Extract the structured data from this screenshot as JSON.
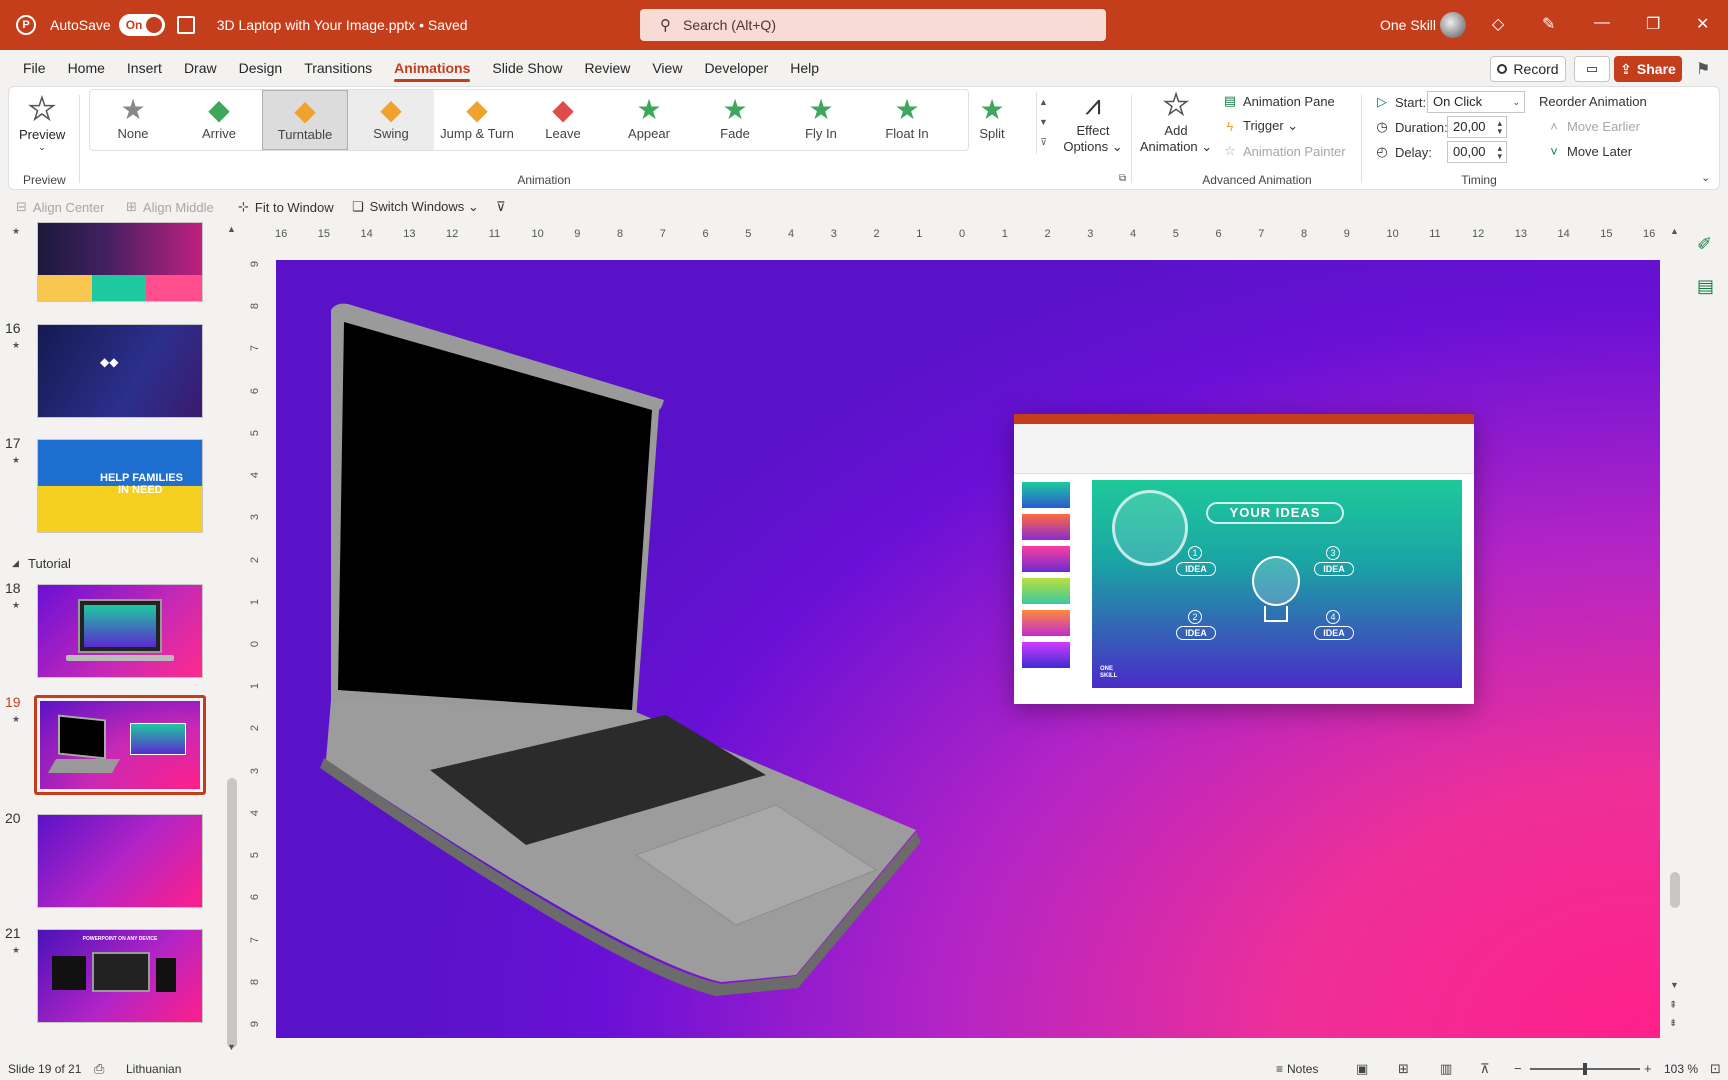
{
  "titlebar": {
    "autosave_label": "AutoSave",
    "autosave_state": "On",
    "filename": "3D Laptop with Your Image.pptx • Saved",
    "filename_chevron": "⌄",
    "search_placeholder": "Search (Alt+Q)",
    "user_name": "One Skill",
    "accent_color": "#c43e1c"
  },
  "menu": {
    "items": [
      "File",
      "Home",
      "Insert",
      "Draw",
      "Design",
      "Transitions",
      "Animations",
      "Slide Show",
      "Review",
      "View",
      "Developer",
      "Help"
    ],
    "active": "Animations",
    "record_label": "Record",
    "share_label": "Share"
  },
  "ribbon": {
    "preview": {
      "label": "Preview",
      "group": "Preview"
    },
    "animations": {
      "group": "Animation",
      "items": [
        "None",
        "Arrive",
        "Turntable",
        "Swing",
        "Jump & Turn",
        "Leave",
        "Appear",
        "Fade",
        "Fly In",
        "Float In",
        "Split"
      ],
      "selected": "Turntable",
      "hovered": "Swing"
    },
    "effect_options": {
      "line1": "Effect",
      "line2": "Options ⌄"
    },
    "advanced": {
      "group": "Advanced Animation",
      "add_line1": "Add",
      "add_line2": "Animation ⌄",
      "pane": "Animation Pane",
      "trigger": "Trigger ⌄",
      "painter": "Animation Painter"
    },
    "timing": {
      "group": "Timing",
      "start_label": "Start:",
      "start_value": "On Click",
      "duration_label": "Duration:",
      "duration_value": "20,00",
      "delay_label": "Delay:",
      "delay_value": "00,00",
      "reorder": "Reorder Animation",
      "move_earlier": "Move Earlier",
      "move_later": "Move Later"
    }
  },
  "qat": {
    "align_center": "Align Center",
    "align_middle": "Align Middle",
    "fit_window": "Fit to Window",
    "switch_windows": "Switch Windows ⌄"
  },
  "thumbnails": {
    "slides": [
      {
        "num": "16"
      },
      {
        "num": "17",
        "text_line1": "HELP FAMILIES",
        "text_line2": "IN NEED"
      },
      {
        "num": "18"
      },
      {
        "num": "19"
      },
      {
        "num": "20"
      },
      {
        "num": "21",
        "text": "POWERPOINT ON ANY DEVICE"
      }
    ],
    "section": "Tutorial",
    "current": "19"
  },
  "ruler": {
    "h_labels": [
      "16",
      "15",
      "14",
      "13",
      "12",
      "11",
      "10",
      "9",
      "8",
      "7",
      "6",
      "5",
      "4",
      "3",
      "2",
      "1",
      "0",
      "1",
      "2",
      "3",
      "4",
      "5",
      "6",
      "7",
      "8",
      "9",
      "10",
      "11",
      "12",
      "13",
      "14",
      "15",
      "16"
    ],
    "v_labels": [
      "9",
      "8",
      "7",
      "6",
      "5",
      "4",
      "3",
      "2",
      "1",
      "0",
      "1",
      "2",
      "3",
      "4",
      "5",
      "6",
      "7",
      "8",
      "9"
    ]
  },
  "slide": {
    "inner_title": "YOUR IDEAS",
    "idea_label": "IDEA",
    "idea_numbers": [
      "1",
      "2",
      "3",
      "4"
    ],
    "brand_line1": "ONE",
    "brand_line2": "SKILL"
  },
  "statusbar": {
    "slide_info": "Slide 19 of 21",
    "language": "Lithuanian",
    "notes": "Notes",
    "zoom": "103 %"
  }
}
